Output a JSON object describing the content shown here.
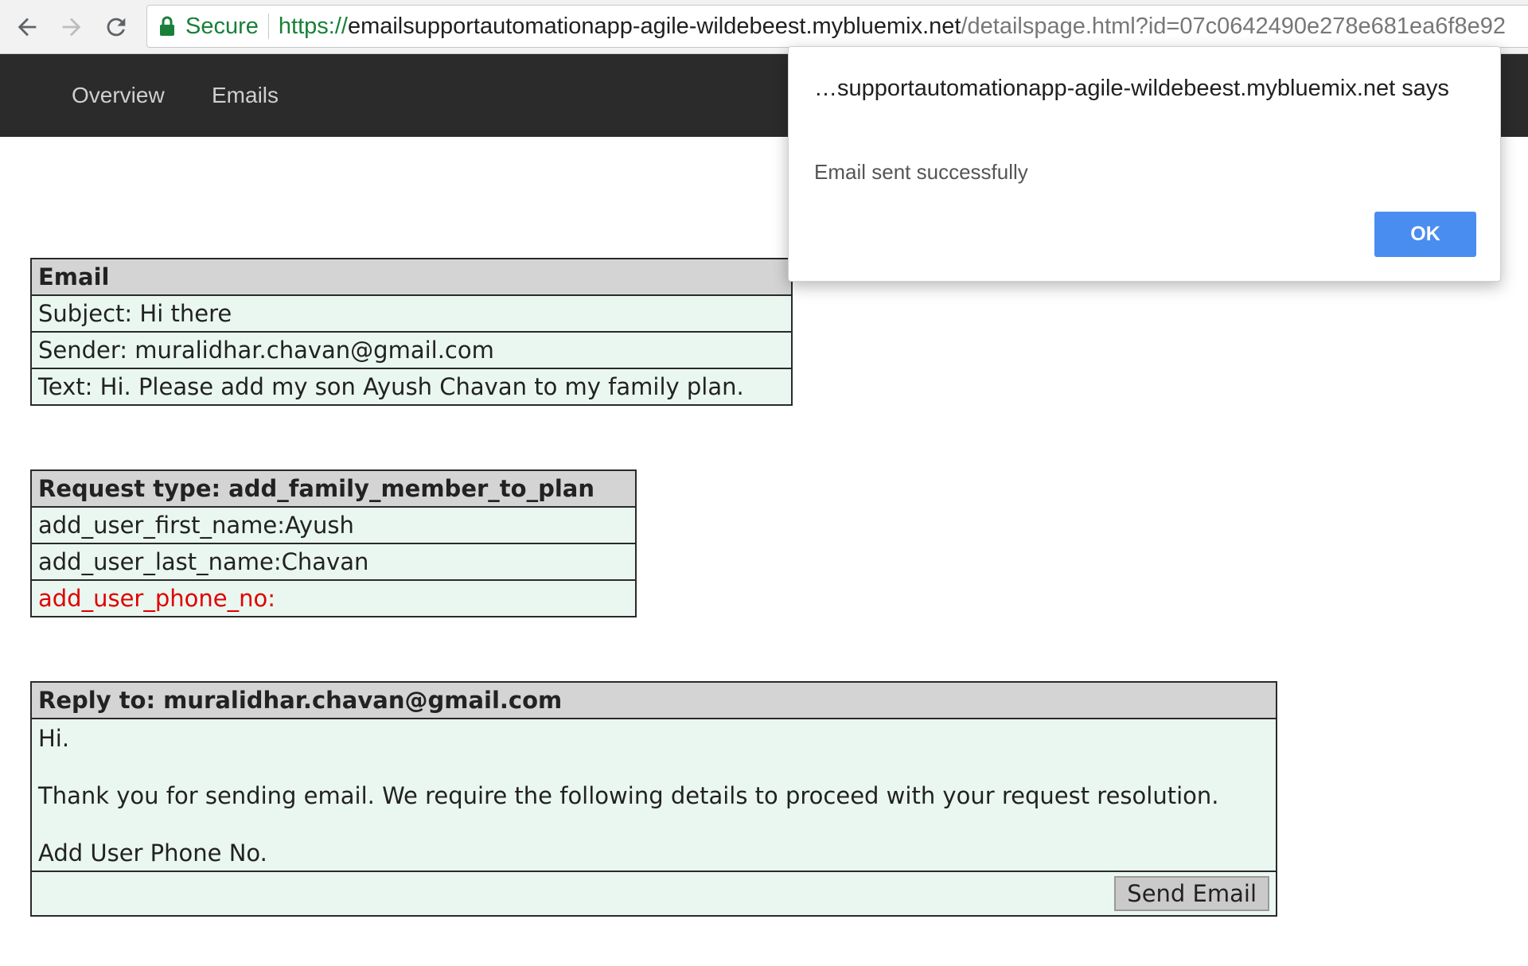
{
  "browser": {
    "secure_label": "Secure",
    "url_scheme": "https://",
    "url_host": "emailsupportautomationapp-agile-wildebeest.mybluemix.net",
    "url_path": "/detailspage.html?id=07c0642490e278e681ea6f8e92"
  },
  "nav": {
    "items": [
      {
        "label": "Overview"
      },
      {
        "label": "Emails"
      }
    ]
  },
  "email": {
    "header": "Email",
    "subject": "Subject: Hi there",
    "sender": "Sender: muralidhar.chavan@gmail.com",
    "text": "Text: Hi. Please add my son Ayush Chavan to my family plan."
  },
  "request": {
    "header": "Request type: add_family_member_to_plan",
    "fields": [
      "add_user_first_name:Ayush",
      "add_user_last_name:Chavan",
      "add_user_phone_no:"
    ]
  },
  "reply": {
    "header": "Reply to: muralidhar.chavan@gmail.com",
    "lines": [
      "Hi.",
      "Thank you for sending email. We require the following details to proceed with your request resolution.",
      "Add User Phone No."
    ],
    "send_label": "Send Email"
  },
  "dialog": {
    "origin": "…supportautomationapp-agile-wildebeest.mybluemix.net says",
    "message": "Email sent successfully",
    "ok_label": "OK"
  },
  "colors": {
    "missing_field": "#e00000",
    "ok_button": "#4a8df0",
    "table_bg": "#eaf7f1",
    "header_bg": "#d4d4d4",
    "nav_bg": "#2b2b2b"
  }
}
